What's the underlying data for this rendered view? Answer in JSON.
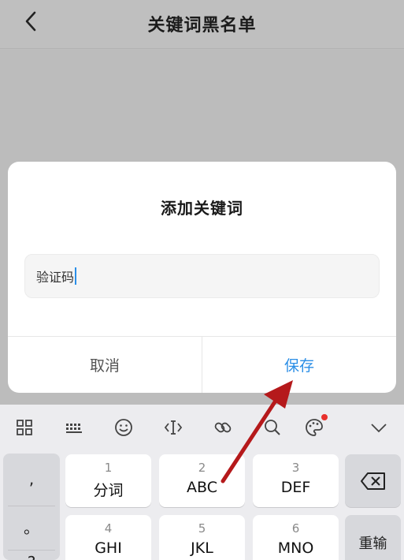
{
  "header": {
    "title": "关键词黑名单"
  },
  "dialog": {
    "title": "添加关键词",
    "input_value": "验证码",
    "cancel_label": "取消",
    "save_label": "保存"
  },
  "keyboard": {
    "keys": [
      {
        "num": "1",
        "label": "分词"
      },
      {
        "num": "2",
        "label": "ABC"
      },
      {
        "num": "3",
        "label": "DEF"
      },
      {
        "num": "4",
        "label": "GHI"
      },
      {
        "num": "5",
        "label": "JKL"
      },
      {
        "num": "6",
        "label": "MNO"
      }
    ],
    "punctuation": [
      ",",
      "。",
      "?"
    ],
    "enter_label": "重输"
  },
  "colors": {
    "accent": "#2b8ee6",
    "arrow": "#b5191b",
    "notify_dot": "#e8302c"
  }
}
